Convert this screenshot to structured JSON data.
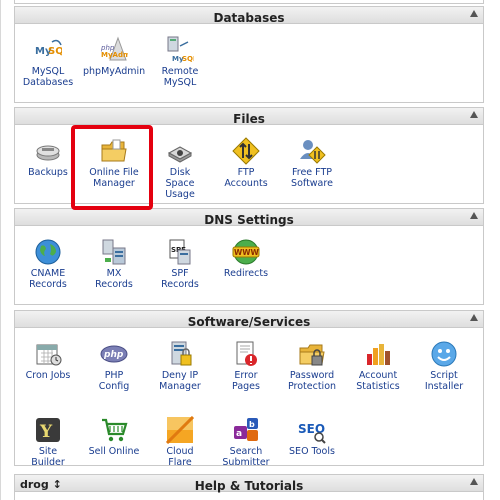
{
  "panels": {
    "databases": {
      "title": "Databases",
      "items": [
        {
          "label": "MySQL\nDatabases",
          "icon": "mysql-icon"
        },
        {
          "label": "phpMyAdmin",
          "icon": "phpmyadmin-icon"
        },
        {
          "label": "Remote\nMySQL",
          "icon": "remote-mysql-icon"
        }
      ]
    },
    "files": {
      "title": "Files",
      "items": [
        {
          "label": "Backups",
          "icon": "backups-icon"
        },
        {
          "label": "Online File\nManager",
          "icon": "folder-icon"
        },
        {
          "label": "Disk\nSpace\nUsage",
          "icon": "disk-icon"
        },
        {
          "label": "FTP\nAccounts",
          "icon": "ftp-icon"
        },
        {
          "label": "Free FTP\nSoftware",
          "icon": "ftp-software-icon"
        }
      ]
    },
    "dns": {
      "title": "DNS Settings",
      "items": [
        {
          "label": "CNAME\nRecords",
          "icon": "globe-icon"
        },
        {
          "label": "MX\nRecords",
          "icon": "mx-icon"
        },
        {
          "label": "SPF\nRecords",
          "icon": "spf-icon"
        },
        {
          "label": "Redirects",
          "icon": "www-icon"
        }
      ]
    },
    "software": {
      "title": "Software/Services",
      "items": [
        {
          "label": "Cron Jobs",
          "icon": "calendar-icon"
        },
        {
          "label": "PHP\nConfig",
          "icon": "php-icon"
        },
        {
          "label": "Deny IP\nManager",
          "icon": "deny-ip-icon"
        },
        {
          "label": "Error\nPages",
          "icon": "error-page-icon"
        },
        {
          "label": "Password\nProtection",
          "icon": "password-folder-icon"
        },
        {
          "label": "Account\nStatistics",
          "icon": "statistics-icon"
        },
        {
          "label": "Script\nInstaller",
          "icon": "script-installer-icon"
        },
        {
          "label": "Site\nBuilder",
          "icon": "site-builder-icon"
        },
        {
          "label": "Sell Online",
          "icon": "shopping-cart-icon"
        },
        {
          "label": "Cloud\nFlare",
          "icon": "cloudflare-icon"
        },
        {
          "label": "Search\nSubmitter",
          "icon": "search-submitter-icon"
        },
        {
          "label": "SEO Tools",
          "icon": "seo-icon"
        }
      ]
    },
    "help": {
      "title": "Help & Tutorials"
    }
  },
  "drag_label": "drog",
  "drag_glyph": "↕",
  "colors": {
    "link": "#1a3d8f",
    "highlight": "#e4000f",
    "header_bg": "#e6e6e6"
  }
}
